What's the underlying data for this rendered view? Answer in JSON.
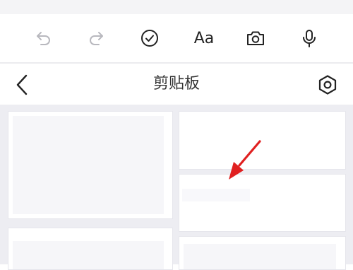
{
  "toolbar": {
    "buttons": [
      {
        "name": "undo",
        "icon": "undo-icon"
      },
      {
        "name": "redo",
        "icon": "redo-icon"
      },
      {
        "name": "check",
        "icon": "check-circle-icon"
      },
      {
        "name": "font",
        "icon": "font-icon",
        "label": "Aa"
      },
      {
        "name": "camera",
        "icon": "camera-icon"
      },
      {
        "name": "microphone",
        "icon": "microphone-icon"
      }
    ]
  },
  "header": {
    "back_icon": "chevron-left-icon",
    "title": "剪贴板",
    "settings_icon": "hexagon-settings-icon"
  },
  "clips": {
    "cards": [
      {
        "id": "clip-1",
        "text": ""
      },
      {
        "id": "clip-2",
        "text": ""
      },
      {
        "id": "clip-3",
        "text": ""
      },
      {
        "id": "clip-4",
        "text": ""
      },
      {
        "id": "clip-5",
        "text": ""
      }
    ]
  },
  "annotation": {
    "icon": "red-arrow-icon",
    "color": "#e02020"
  },
  "colors": {
    "icon_active": "#222222",
    "icon_disabled": "#b8b8be",
    "background": "#ededf2"
  }
}
